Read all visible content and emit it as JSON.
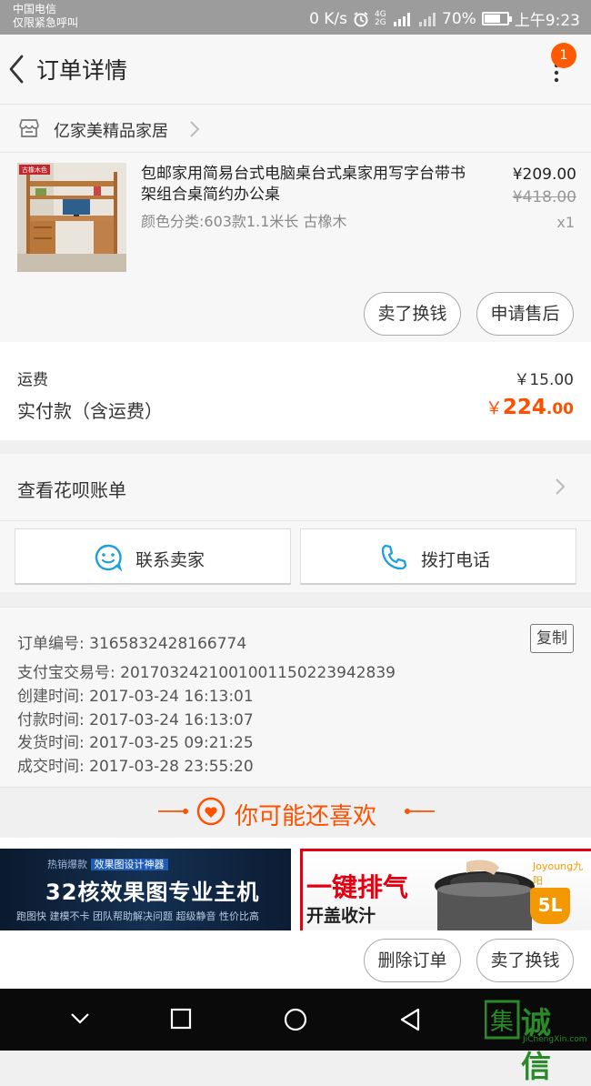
{
  "status_bar": {
    "carrier": "中国电信",
    "emergency": "仅限紧急呼叫",
    "speed": "0 K/s",
    "network": "4G 2G",
    "battery": "70%",
    "battery_level": 0.7,
    "time": "上午9:23"
  },
  "header": {
    "title": "订单详情",
    "badge_count": "1"
  },
  "shop": {
    "name": "亿家美精品家居"
  },
  "item": {
    "thumb_label": "古橡木色",
    "title": "包邮家用简易台式电脑桌台式桌家用写字台带书架组合桌简约办公桌",
    "spec": "颜色分类:603款1.1米长 古橡木",
    "price": "¥209.00",
    "original_price": "¥418.00",
    "quantity": "x1",
    "btn_resell": "卖了换钱",
    "btn_aftersale": "申请售后"
  },
  "fees": {
    "shipping_label": "运费",
    "shipping_value": "￥15.00",
    "paid_label": "实付款（含运费）",
    "paid_symbol": "￥",
    "paid_integer": "224",
    "paid_decimal": ".00"
  },
  "huabei": {
    "label": "查看花呗账单"
  },
  "contact": {
    "seller_label": "联系卖家",
    "phone_label": "拨打电话"
  },
  "order_info": {
    "order_no": "订单编号: 3165832428166774",
    "alipay_no": "支付宝交易号: 2017032421001001150223942839",
    "created": "创建时间: 2017-03-24 16:13:01",
    "paid": "付款时间: 2017-03-24 16:13:07",
    "shipped": "发货时间: 2017-03-25 09:21:25",
    "completed": "成交时间: 2017-03-28 23:55:20",
    "copy_label": "复制"
  },
  "recommend": {
    "title": "你可能还喜欢"
  },
  "banner_left": {
    "tag_prefix": "热销爆款",
    "tag": "效果图设计神器",
    "headline": "32核效果图专业主机",
    "sub": "跑图快   建模不卡   团队帮助解决问题   超级静音 性价比高"
  },
  "banner_right": {
    "headline": "一键排气",
    "sub": "开盖收汁",
    "brand": "Joyoung九阳",
    "capacity": "5L"
  },
  "bottom_actions": {
    "delete_label": "删除订单",
    "resell_label": "卖了换钱"
  },
  "watermark": {
    "logo": "集",
    "text": "诚信",
    "url": "JiChengXin.com"
  },
  "colors": {
    "accent": "#ff5000",
    "badge": "#ff5a00",
    "status_bar": "#9c9c9c",
    "nav_bar": "#0a0a0a"
  }
}
